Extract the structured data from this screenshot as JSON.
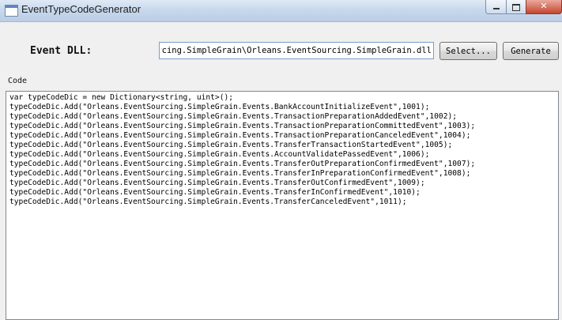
{
  "window": {
    "title": "EventTypeCodeGenerator",
    "minimize_icon": "minimize-icon",
    "maximize_icon": "maximize-icon",
    "close_icon": "close-icon"
  },
  "form": {
    "dll_label": "Event DLL:",
    "dll_path": "ourcing.SimpleGrain\\Orleans.EventSourcing.SimpleGrain.dll",
    "select_button": "Select...",
    "generate_button": "Generate",
    "code_label": "Code"
  },
  "code": {
    "lines": [
      "var typeCodeDic = new Dictionary<string, uint>();",
      "typeCodeDic.Add(\"Orleans.EventSourcing.SimpleGrain.Events.BankAccountInitializeEvent\",1001);",
      "typeCodeDic.Add(\"Orleans.EventSourcing.SimpleGrain.Events.TransactionPreparationAddedEvent\",1002);",
      "typeCodeDic.Add(\"Orleans.EventSourcing.SimpleGrain.Events.TransactionPreparationCommittedEvent\",1003);",
      "typeCodeDic.Add(\"Orleans.EventSourcing.SimpleGrain.Events.TransactionPreparationCanceledEvent\",1004);",
      "typeCodeDic.Add(\"Orleans.EventSourcing.SimpleGrain.Events.TransferTransactionStartedEvent\",1005);",
      "typeCodeDic.Add(\"Orleans.EventSourcing.SimpleGrain.Events.AccountValidatePassedEvent\",1006);",
      "typeCodeDic.Add(\"Orleans.EventSourcing.SimpleGrain.Events.TransferOutPreparationConfirmedEvent\",1007);",
      "typeCodeDic.Add(\"Orleans.EventSourcing.SimpleGrain.Events.TransferInPreparationConfirmedEvent\",1008);",
      "typeCodeDic.Add(\"Orleans.EventSourcing.SimpleGrain.Events.TransferOutConfirmedEvent\",1009);",
      "typeCodeDic.Add(\"Orleans.EventSourcing.SimpleGrain.Events.TransferInConfirmedEvent\",1010);",
      "typeCodeDic.Add(\"Orleans.EventSourcing.SimpleGrain.Events.TransferCanceledEvent\",1011);"
    ]
  }
}
